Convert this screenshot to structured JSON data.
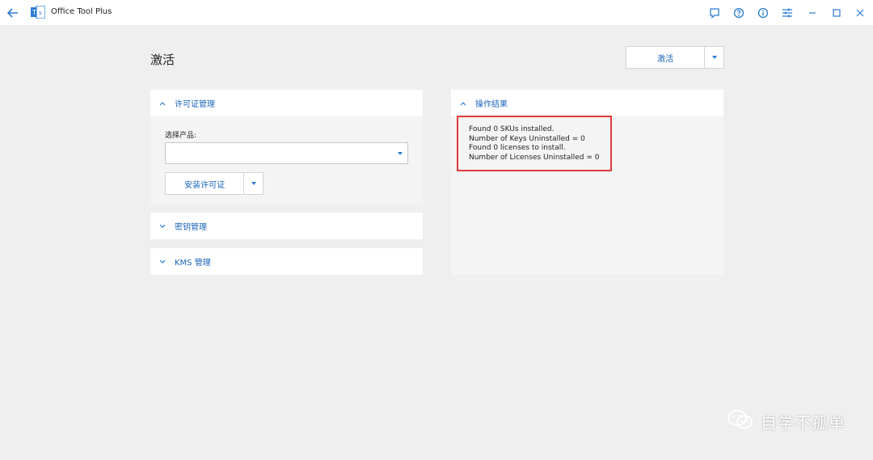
{
  "window": {
    "title": "Office Tool Plus",
    "icons": [
      "back-arrow-icon",
      "app-logo-icon",
      "feedback-icon",
      "help-icon",
      "info-icon",
      "settings-sliders-icon",
      "minimize-icon",
      "maximize-icon",
      "close-icon"
    ]
  },
  "page": {
    "title": "激活",
    "activate_button": "激活"
  },
  "license_panel": {
    "header": "许可证管理",
    "expanded": true,
    "select_label": "选择产品:",
    "select_value": "",
    "install_button": "安装许可证"
  },
  "key_panel": {
    "header": "密钥管理",
    "expanded": false
  },
  "kms_panel": {
    "header": "KMS 管理",
    "expanded": false
  },
  "results_panel": {
    "header": "操作结果",
    "expanded": true,
    "lines": [
      "Found 0 SKUs installed.",
      "Number of Keys Uninstalled = 0",
      "Found 0 licenses to install.",
      "Number of Licenses Uninstalled = 0"
    ]
  },
  "watermark": {
    "text": "自学不孤单"
  },
  "colors": {
    "accent": "#2b7cd3",
    "link_text": "#1a64b8",
    "highlight": "#e03b3b",
    "background": "#efefef"
  }
}
